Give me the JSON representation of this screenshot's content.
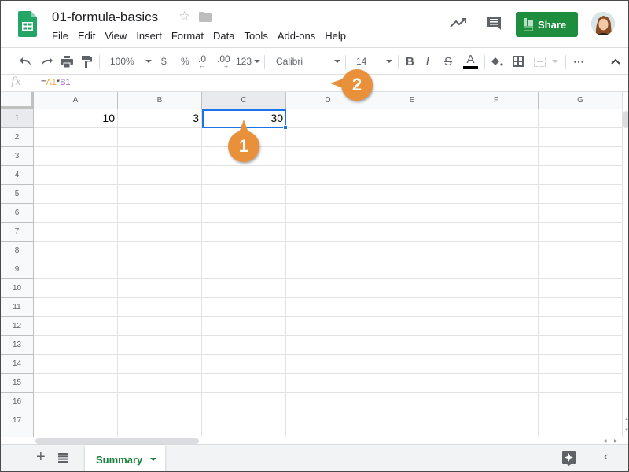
{
  "header": {
    "title": "01-formula-basics",
    "menu": [
      "File",
      "Edit",
      "View",
      "Insert",
      "Format",
      "Data",
      "Tools",
      "Add-ons",
      "Help"
    ],
    "share_label": "Share",
    "accent_color": "#1e8e3e"
  },
  "toolbar": {
    "zoom": "100%",
    "currency": "$",
    "percent": "%",
    "decrease_decimals": ".0",
    "increase_decimals": ".00",
    "more_formats": "123",
    "font": "Calibri",
    "font_size": "14",
    "bold": "B",
    "italic": "I",
    "strikethrough": "S",
    "text_color": "A",
    "more": "⋯"
  },
  "formula_bar": {
    "fx_label": "fx",
    "eq": "=",
    "ref1": "A1",
    "op": "*",
    "ref2": "B1"
  },
  "grid": {
    "columns": [
      "A",
      "B",
      "C",
      "D",
      "E",
      "F",
      "G"
    ],
    "rows": [
      "1",
      "2",
      "3",
      "4",
      "5",
      "6",
      "7",
      "8",
      "9",
      "10",
      "11",
      "12",
      "13",
      "14",
      "15",
      "16",
      "17"
    ],
    "selected_cell": "C1",
    "cells": {
      "A1": "10",
      "B1": "3",
      "C1": "30"
    }
  },
  "sheets": {
    "active": "Summary",
    "add_label": "+"
  },
  "callouts": [
    "1",
    "2"
  ]
}
